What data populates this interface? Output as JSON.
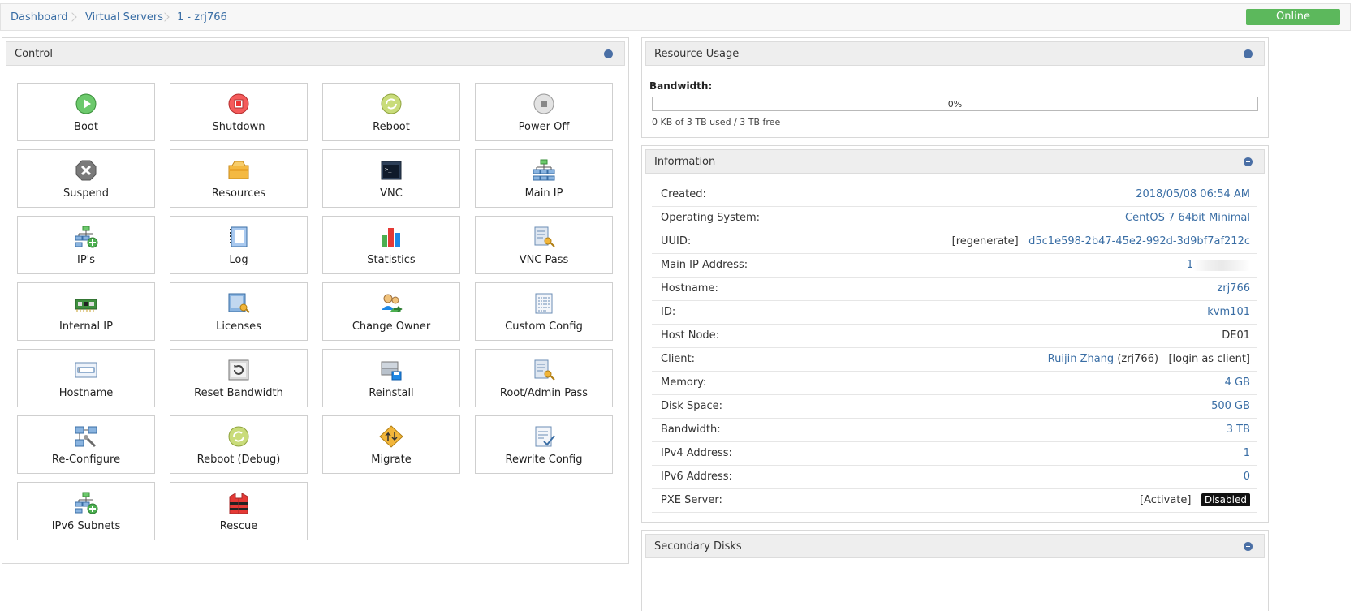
{
  "breadcrumb": {
    "items": [
      "Dashboard",
      "Virtual Servers",
      "1 - zrj766"
    ]
  },
  "status": {
    "label": "Online",
    "color": "#5cb85c"
  },
  "control": {
    "title": "Control",
    "tiles": [
      {
        "label": "Boot",
        "icon": "play-icon"
      },
      {
        "label": "Shutdown",
        "icon": "stop-icon"
      },
      {
        "label": "Reboot",
        "icon": "reboot-icon"
      },
      {
        "label": "Power Off",
        "icon": "power-off-icon"
      },
      {
        "label": "Suspend",
        "icon": "suspend-icon"
      },
      {
        "label": "Resources",
        "icon": "resources-icon"
      },
      {
        "label": "VNC",
        "icon": "terminal-icon"
      },
      {
        "label": "Main IP",
        "icon": "network-icon"
      },
      {
        "label": "IP's",
        "icon": "network-add-icon"
      },
      {
        "label": "Log",
        "icon": "notebook-icon"
      },
      {
        "label": "Statistics",
        "icon": "bar-chart-icon"
      },
      {
        "label": "VNC Pass",
        "icon": "key-document-icon"
      },
      {
        "label": "Internal IP",
        "icon": "network-card-icon"
      },
      {
        "label": "Licenses",
        "icon": "license-key-icon"
      },
      {
        "label": "Change Owner",
        "icon": "users-icon"
      },
      {
        "label": "Custom Config",
        "icon": "config-document-icon"
      },
      {
        "label": "Hostname",
        "icon": "hostname-icon"
      },
      {
        "label": "Reset Bandwidth",
        "icon": "reset-icon"
      },
      {
        "label": "Reinstall",
        "icon": "reinstall-icon"
      },
      {
        "label": "Root/Admin Pass",
        "icon": "key-document-icon"
      },
      {
        "label": "Re-Configure",
        "icon": "reconfigure-icon"
      },
      {
        "label": "Reboot (Debug)",
        "icon": "reboot-icon"
      },
      {
        "label": "Migrate",
        "icon": "migrate-icon"
      },
      {
        "label": "Rewrite Config",
        "icon": "rewrite-config-icon"
      },
      {
        "label": "IPv6 Subnets",
        "icon": "network-add-icon"
      },
      {
        "label": "Rescue",
        "icon": "life-jacket-icon"
      }
    ]
  },
  "resource_usage": {
    "title": "Resource Usage",
    "bandwidth_label": "Bandwidth:",
    "bandwidth_percent_text": "0%",
    "bandwidth_fraction": 0,
    "bandwidth_note": "0 KB of 3 TB used / 3 TB free"
  },
  "information": {
    "title": "Information",
    "rows": [
      {
        "label": "Created:",
        "value": "2018/05/08 06:54 AM"
      },
      {
        "label": "Operating System:",
        "value": "CentOS 7 64bit Minimal"
      },
      {
        "label": "UUID:",
        "prefix": "[regenerate]",
        "value": "d5c1e598-2b47-45e2-992d-3d9bf7af212c"
      },
      {
        "label": "Main IP Address:",
        "value": "1"
      },
      {
        "label": "Hostname:",
        "value": "zrj766"
      },
      {
        "label": "ID:",
        "value": "kvm101"
      },
      {
        "label": "Host Node:",
        "value": "DE01"
      },
      {
        "label": "Client:",
        "value": "Ruijin Zhang",
        "client_user": "(zrj766)",
        "action": "[login as client]"
      },
      {
        "label": "Memory:",
        "value": "4 GB"
      },
      {
        "label": "Disk Space:",
        "value": "500 GB"
      },
      {
        "label": "Bandwidth:",
        "value": "3 TB"
      },
      {
        "label": "IPv4 Address:",
        "value": "1"
      },
      {
        "label": "IPv6 Address:",
        "value": "0"
      },
      {
        "label": "PXE Server:",
        "prefix": "[Activate]",
        "value": "Disabled"
      }
    ]
  },
  "secondary_disks": {
    "title": "Secondary Disks"
  }
}
